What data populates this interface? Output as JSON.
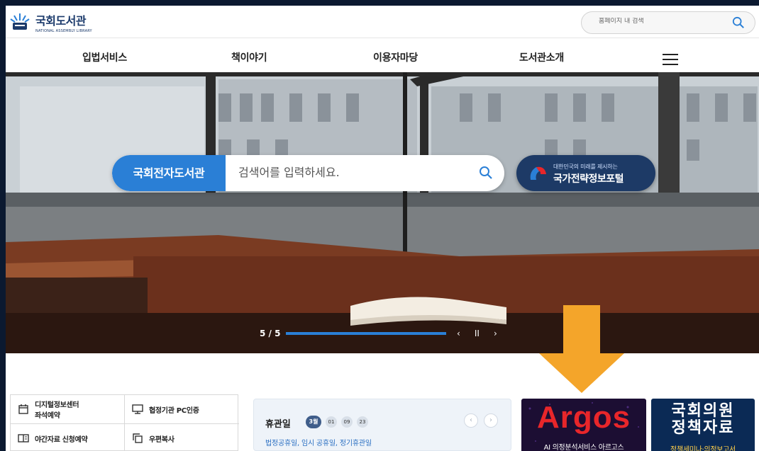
{
  "header": {
    "logo_ko": "국회도서관",
    "logo_en": "NATIONAL ASSEMBLY LIBRARY",
    "search_placeholder": "홈페이지 내 검색"
  },
  "nav": {
    "items": [
      "입법서비스",
      "책이야기",
      "이용자마당",
      "도서관소개"
    ]
  },
  "hero": {
    "search_tag": "국회전자도서관",
    "search_placeholder": "검색어를 입력하세요.",
    "portal_sub": "대한민국의 미래를 제시하는",
    "portal_main": "국가전략정보포털",
    "slide_counter": "5 / 5",
    "slide_progress": 1.0,
    "controls": {
      "prev": "‹",
      "pause": "II",
      "next": "›"
    }
  },
  "quick_links": [
    {
      "icon": "calendar-icon",
      "label": "디지털정보센터\n좌석예약"
    },
    {
      "icon": "monitor-icon",
      "label": "협정기관 PC인증"
    },
    {
      "icon": "book-icon",
      "label": "야간자료 신청예약"
    },
    {
      "icon": "copy-icon",
      "label": "우편복사"
    }
  ],
  "holiday": {
    "title": "휴관일",
    "month": "3월",
    "days": [
      "01",
      "09",
      "23"
    ],
    "desc": "법정공휴일, 임시 공휴일, 정기휴관일",
    "prev": "‹",
    "next": "›"
  },
  "banners": {
    "argos": {
      "name": "Argos",
      "sub": "AI 의정분석서비스 아르고스"
    },
    "policy": {
      "line1": "국회의원",
      "line2": "정책자료",
      "sub": "정책세미나·의정보고서"
    }
  },
  "colors": {
    "accent_blue": "#2a7fd6",
    "portal_navy": "#1d3a66",
    "arrow_orange": "#f4a52a",
    "argos_red": "#e8262a",
    "policy_yellow": "#ffcf4a"
  }
}
